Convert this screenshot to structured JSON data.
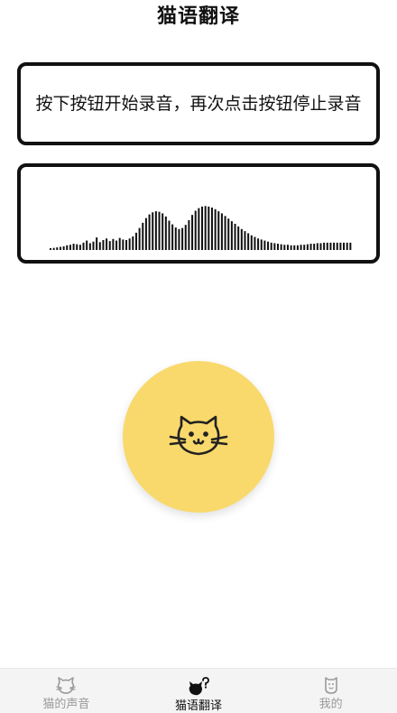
{
  "header": {
    "title": "猫语翻译"
  },
  "instruction": {
    "text": "按下按钮开始录音，再次点击按钮停止录音"
  },
  "waveform": {
    "levels": [
      0.02,
      0.04,
      0.05,
      0.06,
      0.07,
      0.09,
      0.1,
      0.12,
      0.11,
      0.1,
      0.14,
      0.18,
      0.13,
      0.16,
      0.24,
      0.15,
      0.19,
      0.22,
      0.17,
      0.21,
      0.18,
      0.23,
      0.2,
      0.19,
      0.22,
      0.26,
      0.33,
      0.42,
      0.52,
      0.61,
      0.68,
      0.72,
      0.74,
      0.73,
      0.7,
      0.64,
      0.56,
      0.49,
      0.43,
      0.4,
      0.42,
      0.48,
      0.57,
      0.67,
      0.75,
      0.8,
      0.83,
      0.84,
      0.83,
      0.81,
      0.78,
      0.74,
      0.7,
      0.65,
      0.6,
      0.55,
      0.5,
      0.45,
      0.4,
      0.36,
      0.32,
      0.28,
      0.25,
      0.22,
      0.2,
      0.18,
      0.16,
      0.14,
      0.13,
      0.12,
      0.11,
      0.1,
      0.1,
      0.09,
      0.09,
      0.09,
      0.1,
      0.1,
      0.11,
      0.12,
      0.12,
      0.13,
      0.13,
      0.14,
      0.14,
      0.14,
      0.14,
      0.14,
      0.14,
      0.14,
      0.14,
      0.14
    ],
    "color": "#111111"
  },
  "record_button": {
    "color": "#f9d96b",
    "icon": "cat-face-icon"
  },
  "nav": {
    "items": [
      {
        "label": "猫的声音",
        "icon": "cat-head-icon",
        "active": false
      },
      {
        "label": "猫语翻译",
        "icon": "cat-question-icon",
        "active": true
      },
      {
        "label": "我的",
        "icon": "profile-cat-icon",
        "active": false
      }
    ]
  }
}
